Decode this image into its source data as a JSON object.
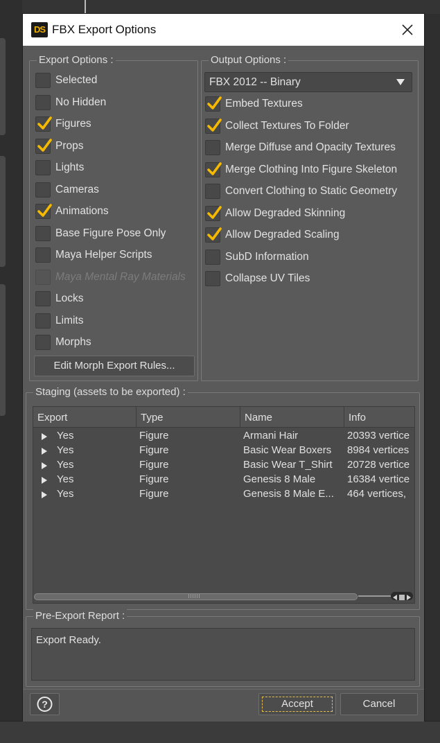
{
  "dialog": {
    "title": "FBX Export Options",
    "app_icon_text": "DS"
  },
  "export_options": {
    "title": "Export Options :",
    "items": [
      {
        "label": "Selected",
        "checked": false,
        "disabled": false
      },
      {
        "label": "No Hidden",
        "checked": false,
        "disabled": false
      },
      {
        "label": "Figures",
        "checked": true,
        "disabled": false
      },
      {
        "label": "Props",
        "checked": true,
        "disabled": false
      },
      {
        "label": "Lights",
        "checked": false,
        "disabled": false
      },
      {
        "label": "Cameras",
        "checked": false,
        "disabled": false
      },
      {
        "label": "Animations",
        "checked": true,
        "disabled": false
      },
      {
        "label": "Base Figure Pose Only",
        "checked": false,
        "disabled": false
      },
      {
        "label": "Maya Helper Scripts",
        "checked": false,
        "disabled": false
      },
      {
        "label": "Maya Mental Ray Materials",
        "checked": false,
        "disabled": true
      },
      {
        "label": "Locks",
        "checked": false,
        "disabled": false
      },
      {
        "label": "Limits",
        "checked": false,
        "disabled": false
      },
      {
        "label": "Morphs",
        "checked": false,
        "disabled": false
      }
    ],
    "edit_morph_button": "Edit Morph Export Rules..."
  },
  "output_options": {
    "title": "Output Options :",
    "format_selected": "FBX 2012 -- Binary",
    "items": [
      {
        "label": "Embed Textures",
        "checked": true
      },
      {
        "label": "Collect Textures To Folder",
        "checked": true
      },
      {
        "label": "Merge Diffuse and Opacity Textures",
        "checked": false
      },
      {
        "label": "Merge Clothing Into Figure Skeleton",
        "checked": true
      },
      {
        "label": "Convert Clothing to Static Geometry",
        "checked": false
      },
      {
        "label": "Allow Degraded Skinning",
        "checked": true
      },
      {
        "label": "Allow Degraded Scaling",
        "checked": true
      },
      {
        "label": "SubD Information",
        "checked": false
      },
      {
        "label": "Collapse UV Tiles",
        "checked": false
      }
    ]
  },
  "staging": {
    "title": "Staging (assets to be exported) :",
    "columns": [
      "Export",
      "Type",
      "Name",
      "Info"
    ],
    "rows": [
      {
        "export": "Yes",
        "type": "Figure",
        "name": "Armani Hair",
        "info": "20393 vertice"
      },
      {
        "export": "Yes",
        "type": "Figure",
        "name": "Basic Wear Boxers",
        "info": "8984 vertices"
      },
      {
        "export": "Yes",
        "type": "Figure",
        "name": "Basic Wear T_Shirt",
        "info": "20728 vertice"
      },
      {
        "export": "Yes",
        "type": "Figure",
        "name": "Genesis 8 Male",
        "info": "16384 vertice"
      },
      {
        "export": "Yes",
        "type": "Figure",
        "name": "Genesis 8 Male E...",
        "info": "464 vertices,"
      }
    ]
  },
  "report": {
    "title": "Pre-Export Report :",
    "text": "Export Ready."
  },
  "buttons": {
    "help": "?",
    "accept": "Accept",
    "cancel": "Cancel"
  },
  "colors": {
    "check": "#f5b900",
    "focus_outline": "#e8c24a"
  }
}
